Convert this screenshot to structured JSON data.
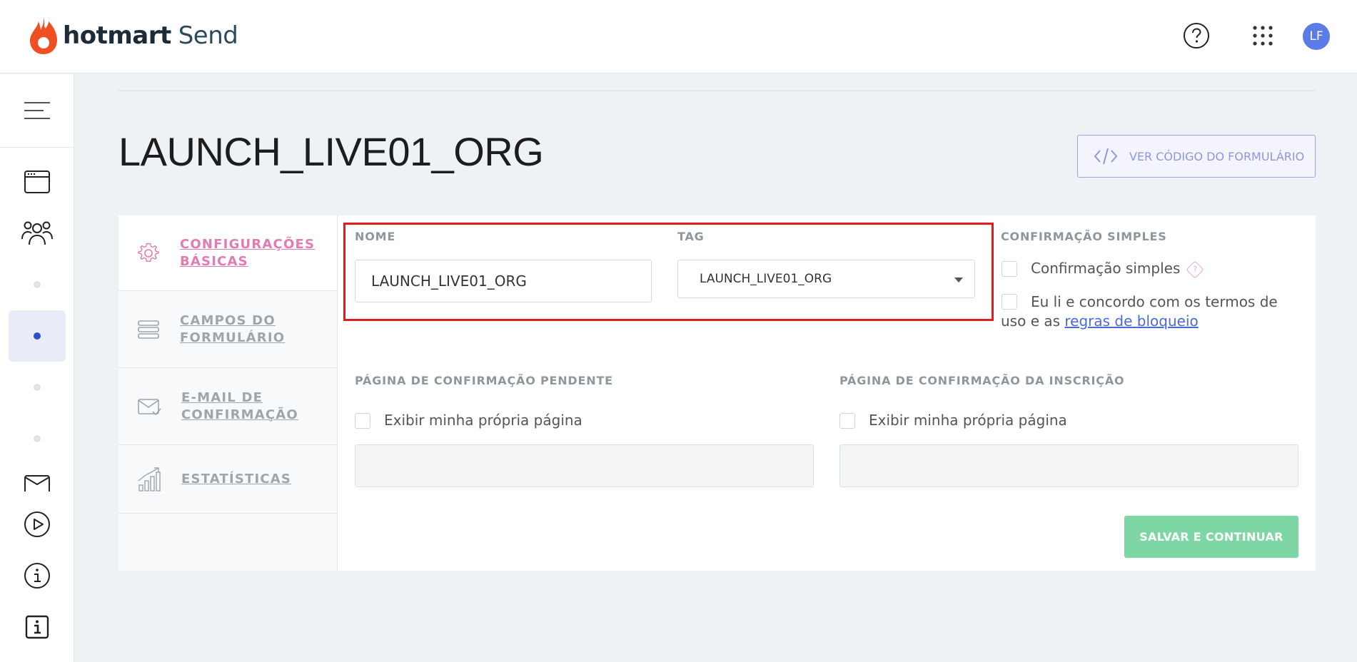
{
  "header": {
    "brand": "hotmart",
    "product": "Send",
    "avatar_initials": "LF"
  },
  "sidebar": {
    "items": [
      {
        "icon": "browser-window-icon"
      },
      {
        "icon": "users-group-icon"
      },
      {
        "icon": "dot-icon"
      },
      {
        "icon": "dot-icon",
        "active": true
      },
      {
        "icon": "dot-icon"
      },
      {
        "icon": "dot-icon"
      },
      {
        "icon": "envelope-icon"
      },
      {
        "icon": "play-circle-icon"
      },
      {
        "icon": "info-circle-icon"
      },
      {
        "icon": "info-square-icon"
      }
    ]
  },
  "page": {
    "title": "LAUNCH_LIVE01_ORG",
    "code_button_label": "VER CÓDIGO DO FORMULÁRIO"
  },
  "tabs": [
    {
      "line1": "CONFIGURAÇÕES",
      "line2": "BÁSICAS",
      "icon": "gear-icon",
      "active": true
    },
    {
      "line1": "CAMPOS DO",
      "line2": "FORMULÁRIO",
      "icon": "list-icon"
    },
    {
      "line1": "E-MAIL DE",
      "line2": "CONFIRMAÇÃO",
      "icon": "mail-check-icon"
    },
    {
      "line1": "ESTATÍSTICAS",
      "line2": "",
      "icon": "chart-growth-icon"
    }
  ],
  "form": {
    "nome_label": "NOME",
    "nome_value": "LAUNCH_LIVE01_ORG",
    "tag_label": "TAG",
    "tag_value": "LAUNCH_LIVE01_ORG",
    "confirmacao_label": "CONFIRMAÇÃO SIMPLES",
    "confirmacao_checkbox": "Confirmação simples",
    "terms_text": "Eu li e concordo com os termos de uso e as",
    "terms_link": "regras de bloqueio",
    "pendente_label": "PÁGINA DE CONFIRMAÇÃO PENDENTE",
    "pendente_checkbox": "Exibir minha própria página",
    "inscricao_label": "PÁGINA DE CONFIRMAÇÃO DA INSCRIÇÃO",
    "inscricao_checkbox": "Exibir minha própria página",
    "save_label": "SALVAR E CONTINUAR"
  },
  "colors": {
    "accent_pink": "#e07bb3",
    "save_green": "#7dd6a4",
    "avatar_blue": "#5b7be6",
    "highlight_red": "#e31b1b"
  }
}
